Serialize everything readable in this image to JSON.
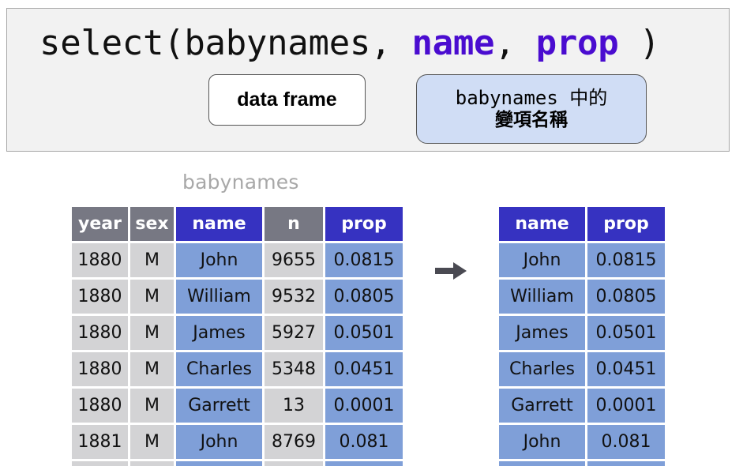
{
  "code": {
    "function": "select",
    "open": "(",
    "dataset": "babynames",
    "sep": ", ",
    "args": [
      "name",
      "prop"
    ],
    "close": " )",
    "arg_color": "#4a0cd0"
  },
  "annotations": {
    "data_frame_label": "data frame",
    "variables_label_line1": "babynames 中的",
    "variables_label_line2": "變項名稱"
  },
  "source_table": {
    "title": "babynames",
    "columns": [
      {
        "label": "year",
        "selected": false
      },
      {
        "label": "sex",
        "selected": false
      },
      {
        "label": "name",
        "selected": true
      },
      {
        "label": "n",
        "selected": false
      },
      {
        "label": "prop",
        "selected": true
      }
    ],
    "rows": [
      [
        "1880",
        "M",
        "John",
        "9655",
        "0.0815"
      ],
      [
        "1880",
        "M",
        "William",
        "9532",
        "0.0805"
      ],
      [
        "1880",
        "M",
        "James",
        "5927",
        "0.0501"
      ],
      [
        "1880",
        "M",
        "Charles",
        "5348",
        "0.0451"
      ],
      [
        "1880",
        "M",
        "Garrett",
        "13",
        "0.0001"
      ],
      [
        "1881",
        "M",
        "John",
        "8769",
        "0.081"
      ]
    ]
  },
  "result_table": {
    "columns": [
      {
        "label": "name",
        "selected": true
      },
      {
        "label": "prop",
        "selected": true
      }
    ],
    "rows": [
      [
        "John",
        "0.0815"
      ],
      [
        "William",
        "0.0805"
      ],
      [
        "James",
        "0.0501"
      ],
      [
        "Charles",
        "0.0451"
      ],
      [
        "Garrett",
        "0.0001"
      ],
      [
        "John",
        "0.081"
      ]
    ]
  },
  "colors": {
    "header_selected": "#3632c1",
    "header_unselected": "#777883",
    "cell_selected": "#7f9fd8",
    "cell_unselected": "#d3d3d5",
    "arrow": "#4a4a52"
  },
  "icons": {
    "transform_arrow": "right-arrow-icon"
  }
}
